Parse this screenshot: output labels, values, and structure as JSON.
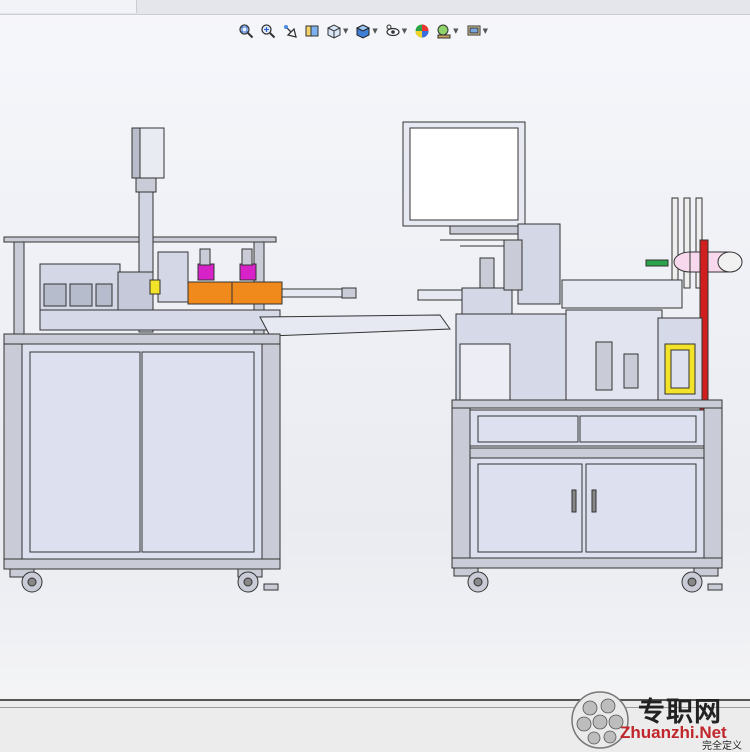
{
  "toolbar": {
    "buttons": [
      {
        "name": "zoom-to-fit-icon"
      },
      {
        "name": "zoom-to-area-icon"
      },
      {
        "name": "previous-view-icon"
      },
      {
        "name": "section-view-icon"
      },
      {
        "name": "view-orientation-icon",
        "dropdown": true
      },
      {
        "name": "display-style-icon",
        "dropdown": true
      },
      {
        "name": "hide-show-items-icon",
        "dropdown": true
      },
      {
        "name": "edit-appearance-icon"
      },
      {
        "name": "apply-scene-icon",
        "dropdown": true
      },
      {
        "name": "view-settings-icon",
        "dropdown": true
      }
    ]
  },
  "colors": {
    "frame": "#c9ccd6",
    "panel": "#dde0ef",
    "outline": "#333333",
    "accent_orange": "#f08a1c",
    "accent_magenta": "#d622c6",
    "accent_yellow": "#f3e22a",
    "accent_red": "#d11f1f",
    "accent_green": "#2aa34a"
  },
  "watermark": {
    "site_name": "专职网",
    "url": "Zhuanzhi.Net"
  },
  "status": {
    "text": "完全定义"
  }
}
